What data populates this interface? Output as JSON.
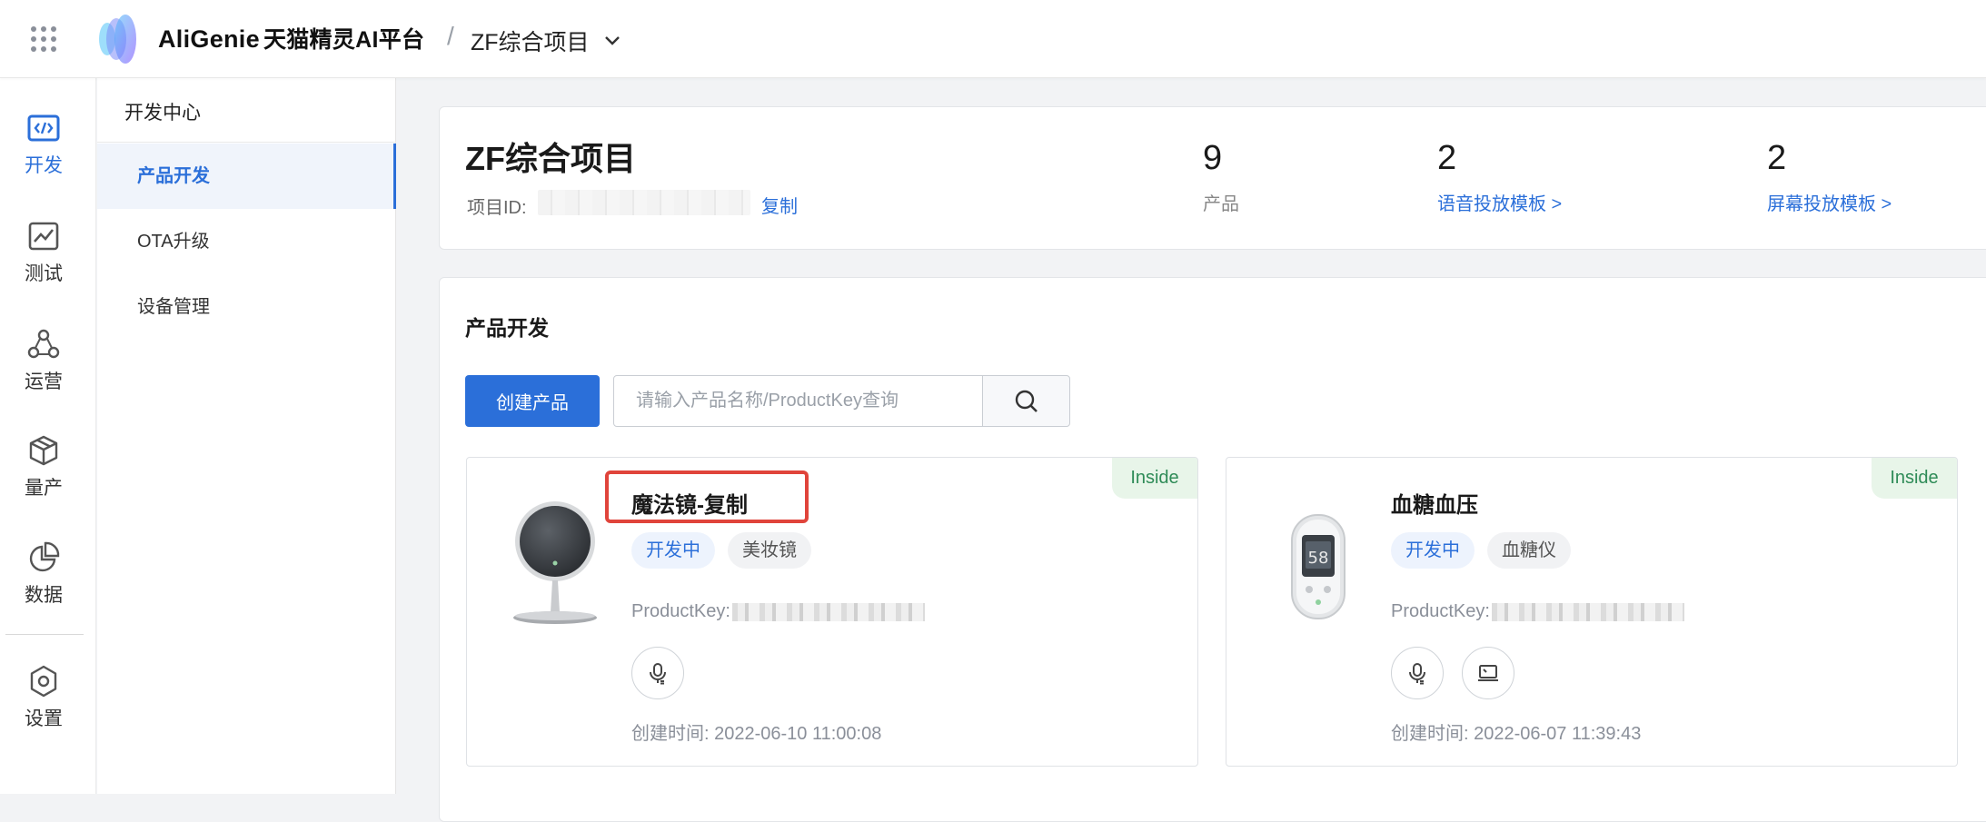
{
  "header": {
    "brand_en": "AliGenie",
    "brand_cn": "天猫精灵AI平台",
    "crumb_sep": "/",
    "project": "ZF综合项目"
  },
  "rail": {
    "items": [
      {
        "label": "开发",
        "icon": "code-icon"
      },
      {
        "label": "测试",
        "icon": "chart-line-icon"
      },
      {
        "label": "运营",
        "icon": "network-icon"
      },
      {
        "label": "量产",
        "icon": "cube-icon"
      },
      {
        "label": "数据",
        "icon": "pie-chart-icon"
      },
      {
        "label": "设置",
        "icon": "gear-icon"
      }
    ],
    "active_color": "#2b6fd9"
  },
  "subnav": {
    "title": "开发中心",
    "items": [
      {
        "label": "产品开发"
      },
      {
        "label": "OTA升级"
      },
      {
        "label": "设备管理"
      }
    ]
  },
  "summary": {
    "name": "ZF综合项目",
    "id_label": "项目ID:",
    "copy": "复制",
    "stats": [
      {
        "num": "9",
        "caption": "产品"
      },
      {
        "num": "2",
        "caption": "语音投放模板 >"
      },
      {
        "num": "2",
        "caption": "屏幕投放模板 >"
      }
    ]
  },
  "products_section": {
    "title": "产品开发",
    "create_btn": "创建产品",
    "search_placeholder": "请输入产品名称/ProductKey查询",
    "cards": [
      {
        "badge": "Inside",
        "title": "魔法镜-复制",
        "status": "开发中",
        "category": "美妆镜",
        "productkey_label": "ProductKey:",
        "created": "创建时间:  2022-06-10 11:00:08"
      },
      {
        "badge": "Inside",
        "title": "血糖血压",
        "status": "开发中",
        "category": "血糖仪",
        "productkey_label": "ProductKey:",
        "created": "创建时间:  2022-06-07 11:39:43"
      }
    ]
  },
  "colors": {
    "primary": "#2b6fd9",
    "badge_bg": "#e8f5e9",
    "badge_text": "#2e8b57",
    "highlight": "#e0443b"
  }
}
